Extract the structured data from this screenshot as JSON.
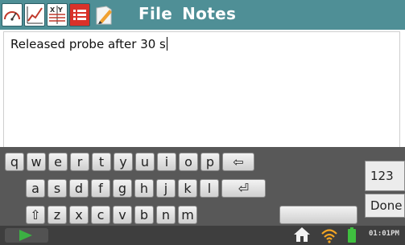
{
  "app": {
    "menu_label": "File",
    "screen_title": "Notes"
  },
  "toolbar_icons": [
    "meter-icon",
    "graph-icon",
    "xy-table-icon",
    "list-icon",
    "pencil-icon"
  ],
  "notes": {
    "text": "Released probe after 30 s"
  },
  "keyboard": {
    "row1": [
      "q",
      "w",
      "e",
      "r",
      "t",
      "y",
      "u",
      "i",
      "o",
      "p",
      "⇦"
    ],
    "row2": [
      "a",
      "s",
      "d",
      "f",
      "g",
      "h",
      "j",
      "k",
      "l",
      "⏎"
    ],
    "row3": [
      "⇧",
      "z",
      "x",
      "c",
      "v",
      "b",
      "n",
      "m"
    ],
    "numbers_key": "123",
    "done_key": "Done"
  },
  "status": {
    "time": "01:01PM"
  },
  "colors": {
    "titlebar": "#4f8f96",
    "keyboard_bg": "#585858",
    "play": "#3cb043"
  }
}
